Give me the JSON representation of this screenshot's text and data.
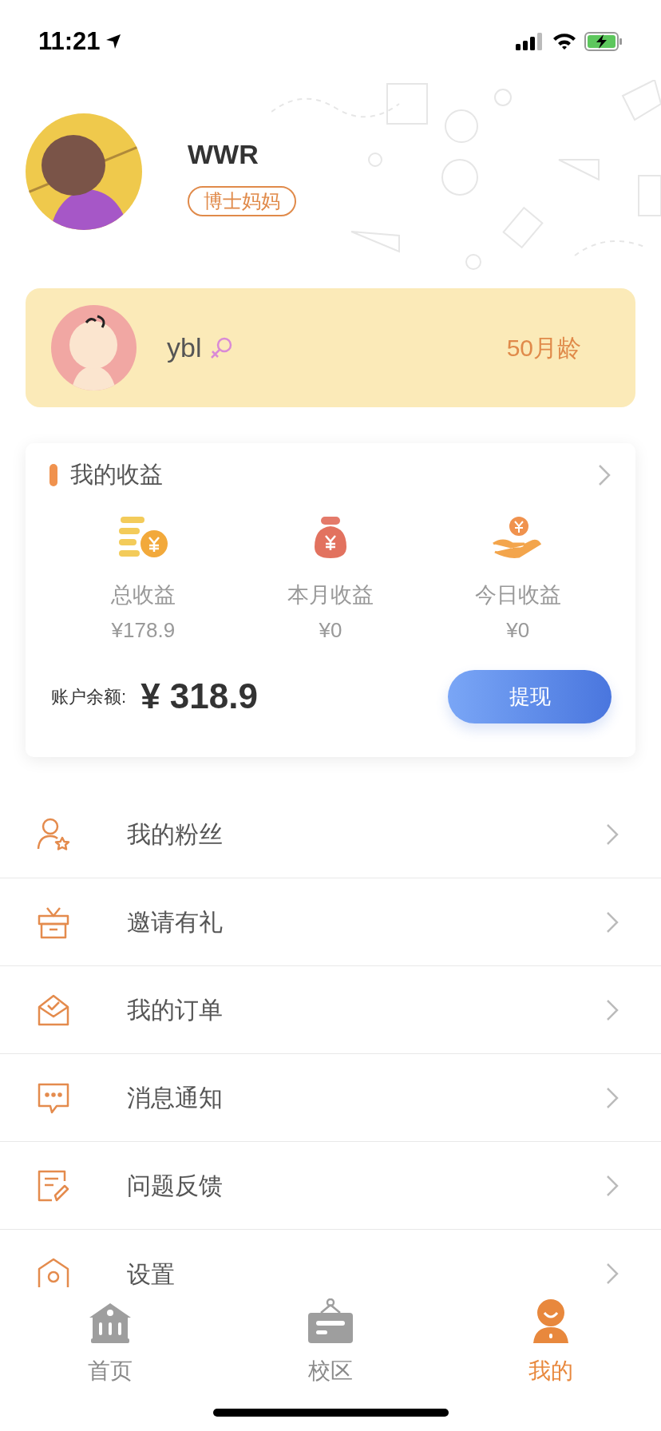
{
  "status_bar": {
    "time": "11:21"
  },
  "profile": {
    "name": "WWR",
    "badge": "博士妈妈"
  },
  "child": {
    "name": "ybl",
    "age": "50月龄"
  },
  "earnings": {
    "title": "我的收益",
    "stats": [
      {
        "label": "总收益",
        "value": "¥178.9"
      },
      {
        "label": "本月收益",
        "value": "¥0"
      },
      {
        "label": "今日收益",
        "value": "¥0"
      }
    ],
    "balance_label": "账户余额:",
    "balance": "¥ 318.9",
    "withdraw_button": "提现"
  },
  "menu": [
    {
      "label": "我的粉丝"
    },
    {
      "label": "邀请有礼"
    },
    {
      "label": "我的订单"
    },
    {
      "label": "消息通知"
    },
    {
      "label": "问题反馈"
    },
    {
      "label": "设置"
    }
  ],
  "tabs": [
    {
      "label": "首页",
      "selected": false
    },
    {
      "label": "校区",
      "selected": false
    },
    {
      "label": "我的",
      "selected": true
    }
  ]
}
